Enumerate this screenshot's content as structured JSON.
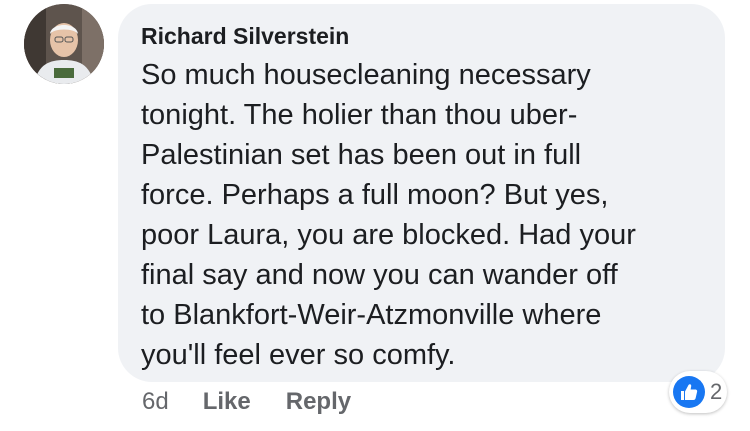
{
  "comment": {
    "author": "Richard Silverstein",
    "text_lines": [
      "So much housecleaning necessary",
      "tonight. The holier than thou uber-",
      "Palestinian set has been out in full",
      "force. Perhaps a full moon?  But yes,",
      "poor Laura, you are blocked.  Had your",
      "final say and now you can wander off",
      "to Blankfort-Weir-Atzmonville where",
      "you'll feel ever so comfy."
    ],
    "timestamp": "6d",
    "like_label": "Like",
    "reply_label": "Reply",
    "reaction_icon": "thumbs-up-icon",
    "reaction_count": "2"
  },
  "colors": {
    "bubble": "#f0f2f5",
    "like_blue": "#1877f2",
    "meta_gray": "#65676b"
  }
}
